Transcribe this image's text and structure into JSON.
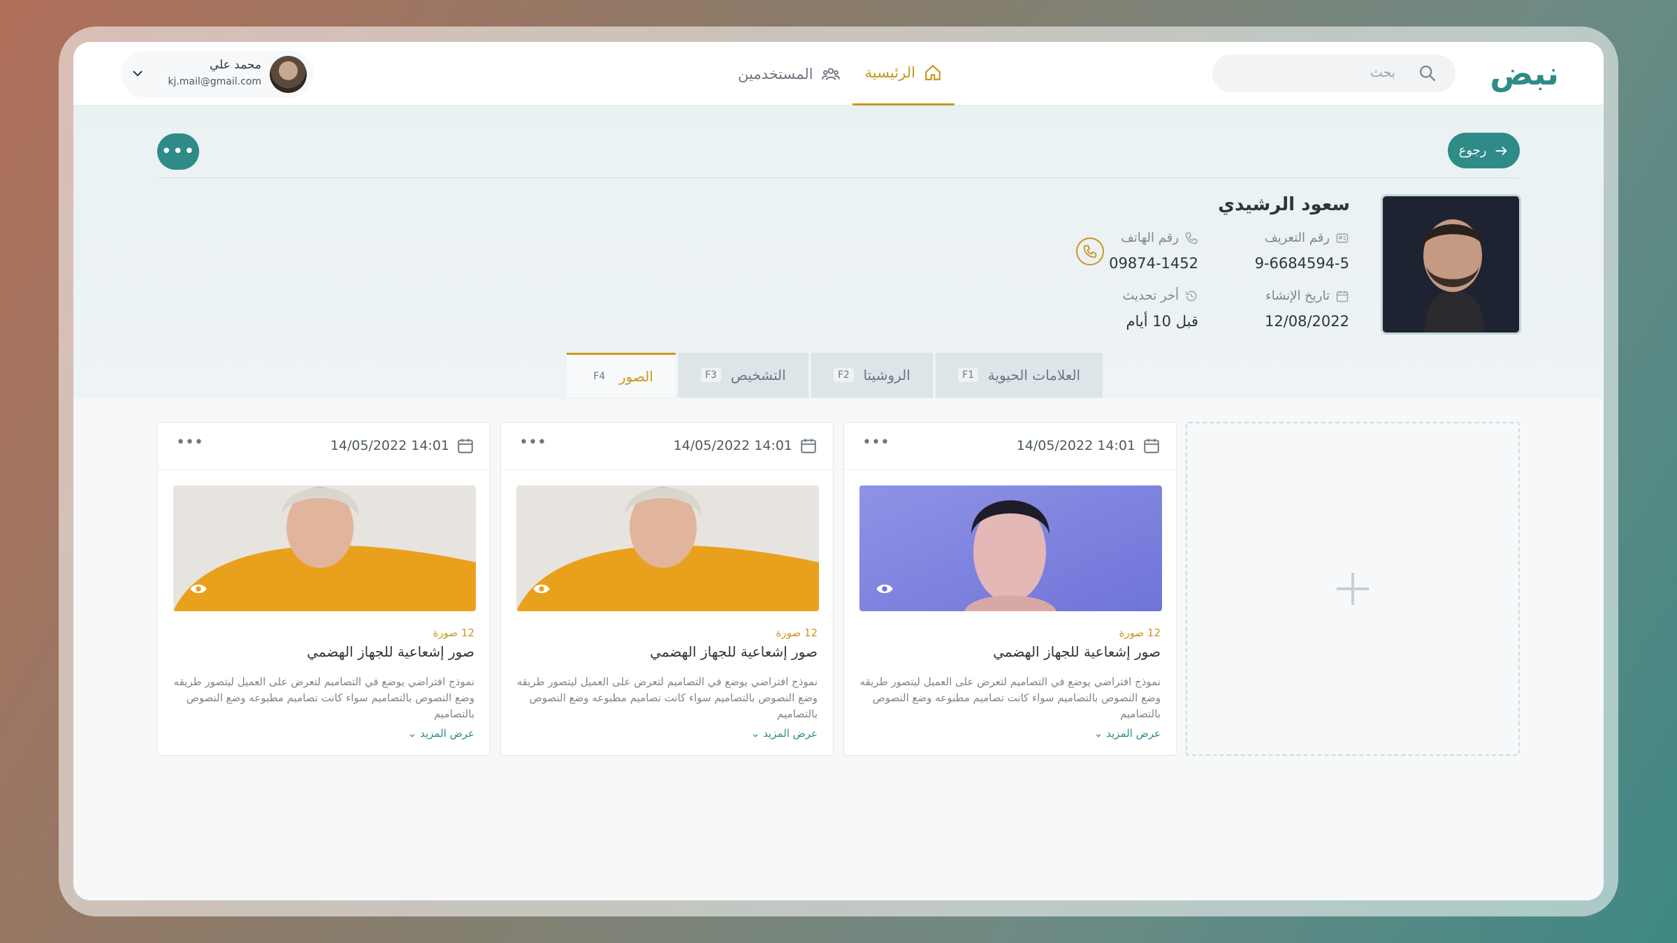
{
  "app": {
    "logo": "نبض"
  },
  "search": {
    "placeholder": "بحث"
  },
  "nav": [
    {
      "label": "الرئيسية",
      "active": true
    },
    {
      "label": "المستخدمين",
      "active": false
    }
  ],
  "user": {
    "name": "محمد علي",
    "email": "kj.mail@gmail.com"
  },
  "toolbar": {
    "back_label": "رجوع",
    "more_label": "•••"
  },
  "patient": {
    "name": "سعود الرشيدي",
    "id_label": "رقم التعريف",
    "id_value": "9-6684594-5",
    "phone_label": "رقم الهاتف",
    "phone_value": "09874-1452",
    "created_label": "تاريخ الإنشاء",
    "created_value": "12/08/2022",
    "updated_label": "أخر تحديث",
    "updated_value": "قبل 10 أيام"
  },
  "tabs": [
    {
      "label": "العلامات الحيوية",
      "key": "F1"
    },
    {
      "label": "الروشيتا",
      "key": "F2"
    },
    {
      "label": "التشخيص",
      "key": "F3"
    },
    {
      "label": "الصور",
      "key": "F4",
      "active": true
    }
  ],
  "cards": [
    {
      "date": "14/05/2022 14:01",
      "count": "12 صورة",
      "title": "صور إشعاعية للجهاز الهضمي",
      "description": "نموذج افتراضي يوضع في التصاميم لتعرض على العميل ليتصور طريقه وضع النصوص بالتصاميم سواء كانت تصاميم مطبوعه وضع النصوص بالتصاميم",
      "more": "عرض المزيد",
      "image": "woman-blue-portrait"
    },
    {
      "date": "14/05/2022 14:01",
      "count": "12 صورة",
      "title": "صور إشعاعية للجهاز الهضمي",
      "description": "نموذج افتراضي يوضع في التصاميم لتعرض على العميل ليتصور طريقه وضع النصوص بالتصاميم سواء كانت تصاميم مطبوعه وضع النصوص بالتصاميم",
      "more": "عرض المزيد",
      "image": "elderly-woman-yellow-sweater"
    },
    {
      "date": "14/05/2022 14:01",
      "count": "12 صورة",
      "title": "صور إشعاعية للجهاز الهضمي",
      "description": "نموذج افتراضي يوضع في التصاميم لتعرض على العميل ليتصور طريقه وضع النصوص بالتصاميم سواء كانت تصاميم مطبوعه وضع النصوص بالتصاميم",
      "more": "عرض المزيد",
      "image": "elderly-woman-yellow-sweater"
    }
  ],
  "colors": {
    "primary": "#2e8b87",
    "accent": "#c9971f"
  }
}
